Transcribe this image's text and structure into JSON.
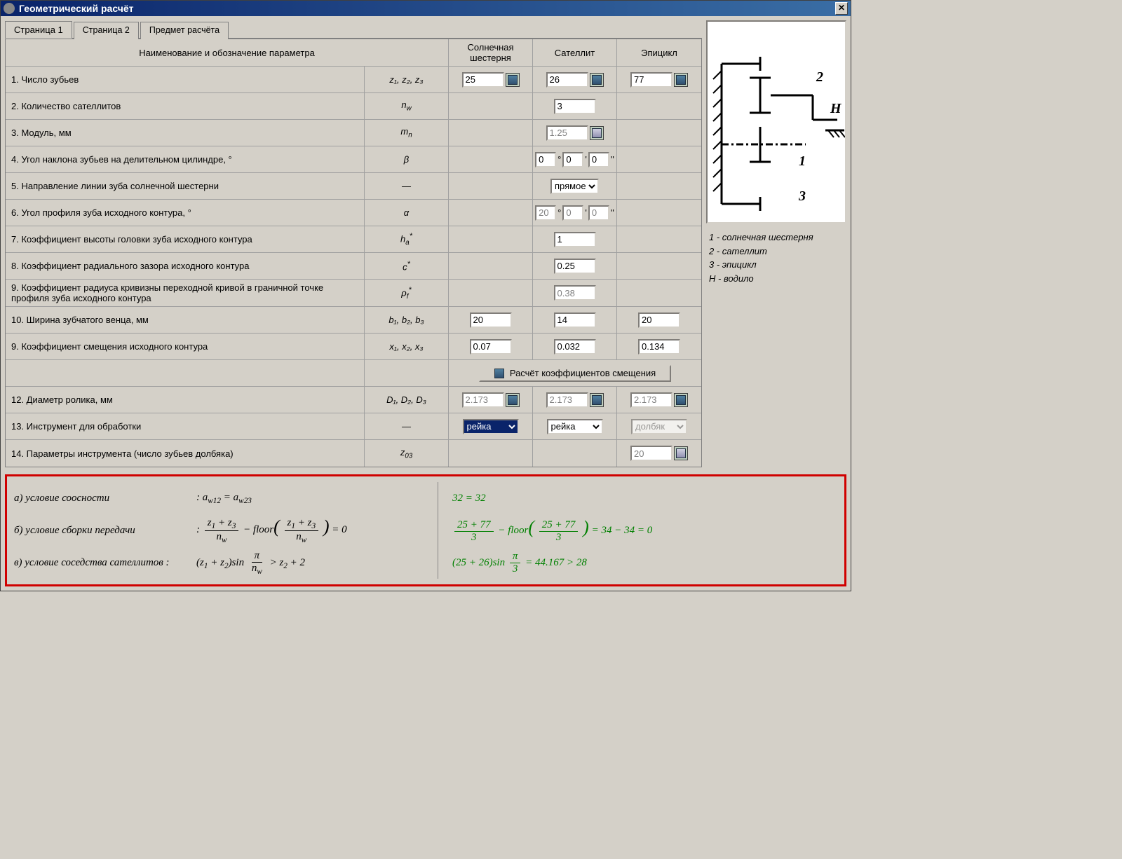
{
  "window": {
    "title": "Геометрический расчёт"
  },
  "tabs": [
    "Страница 1",
    "Страница 2",
    "Предмет расчёта"
  ],
  "columns": {
    "name": "Наименование и обозначение параметра",
    "c1": "Солнечная шестерня",
    "c2": "Сателлит",
    "c3": "Эпицикл"
  },
  "rows": {
    "r1": {
      "label": "1. Число зубьев",
      "sym": "z₁,  z₂,  z₃",
      "v1": "25",
      "v2": "26",
      "v3": "77"
    },
    "r2": {
      "label": "2. Количество сателлитов",
      "sym": "nₓ",
      "sym2": "n",
      "sub": "w",
      "v": "3"
    },
    "r3": {
      "label": "3. Модуль, мм",
      "sym": "m",
      "sub": "n",
      "v": "1.25"
    },
    "r4": {
      "label": "4. Угол наклона зубьев на делительном цилиндре, °",
      "sym": "β",
      "d": "0",
      "m": "0",
      "s": "0"
    },
    "r5": {
      "label": "5. Направление линии зуба солнечной шестерни",
      "sym": "—",
      "v": "прямое"
    },
    "r6": {
      "label": "6. Угол профиля зуба исходного контура, °",
      "sym": "α",
      "d": "20",
      "m": "0",
      "s": "0"
    },
    "r7": {
      "label": "7. Коэффициент высоты головки зуба исходного контура",
      "sym": "h",
      "sub": "a",
      "sup": "*",
      "v": "1"
    },
    "r8": {
      "label": "8. Коэффициент радиального зазора исходного контура",
      "sym": "c",
      "sup": "*",
      "v": "0.25"
    },
    "r9": {
      "label": "9. Коэффициент радиуса кривизны переходной кривой в граничной точке профиля зуба исходного контура",
      "sym": "ρ",
      "sub": "f",
      "sup": "*",
      "v": "0.38"
    },
    "r10": {
      "label": "10. Ширина зубчатого венца, мм",
      "sym": "b₁,  b₂,  b₃",
      "v1": "20",
      "v2": "14",
      "v3": "20"
    },
    "r11": {
      "label": "9. Коэффициент смещения исходного контура",
      "sym": "x₁,  x₂,  x₃",
      "v1": "0.07",
      "v2": "0.032",
      "v3": "0.134"
    },
    "rbtn": {
      "label": "Расчёт коэффициентов смещения"
    },
    "r12": {
      "label": "12. Диаметр ролика, мм",
      "sym": "D₁,  D₂,  D₃",
      "v1": "2.173",
      "v2": "2.173",
      "v3": "2.173"
    },
    "r13": {
      "label": "13. Инструмент для обработки",
      "sym": "—",
      "v1": "рейка",
      "v2": "рейка",
      "v3": "долбяк"
    },
    "r14": {
      "label": "14. Параметры инструмента (число зубьев долбяка)",
      "sym": "z",
      "sub": "03",
      "v": "20"
    }
  },
  "legend": {
    "l1": "1 - солнечная шестерня",
    "l2": "2 - сателлит",
    "l3": "3 - эпицикл",
    "l4": "H - водило"
  },
  "formulas": {
    "a": {
      "label": "а) условие соосности",
      "lhs": ": a",
      "sub1": "w12",
      "mid": " = a",
      "sub2": "w23",
      "rhs": "32 = 32"
    },
    "b": {
      "label": "б) условие сборки передачи"
    },
    "c": {
      "label": "в) условие соседства сателлитов :"
    }
  }
}
